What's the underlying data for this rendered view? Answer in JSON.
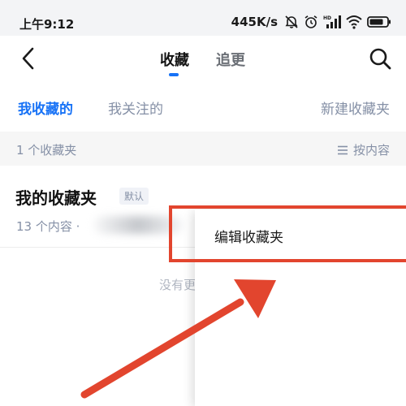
{
  "status_bar": {
    "time": "上午9:12",
    "network_speed": "445K/s",
    "battery_level": 0.8
  },
  "nav": {
    "tabs": [
      {
        "label": "收藏",
        "active": true
      },
      {
        "label": "追更",
        "active": false
      }
    ]
  },
  "sub_tabs": {
    "mine": "我收藏的",
    "followed": "我关注的",
    "new_folder": "新建收藏夹"
  },
  "info_bar": {
    "count": "1 个收藏夹",
    "sort": "按内容"
  },
  "collection": {
    "title": "我的收藏夹",
    "badge": "默认",
    "meta": "13 个内容 ·"
  },
  "empty_text": "没有更多内容",
  "popup_menu": {
    "edit": "编辑收藏夹"
  },
  "colors": {
    "accent": "#1772f6",
    "annotation": "#e2452e",
    "secondary_text": "#8590a6"
  },
  "icons": [
    "back-arrow-icon",
    "search-icon",
    "list-sort-icon",
    "mute-bell-icon",
    "alarm-icon",
    "signal-icon",
    "wifi-icon",
    "battery-icon"
  ]
}
